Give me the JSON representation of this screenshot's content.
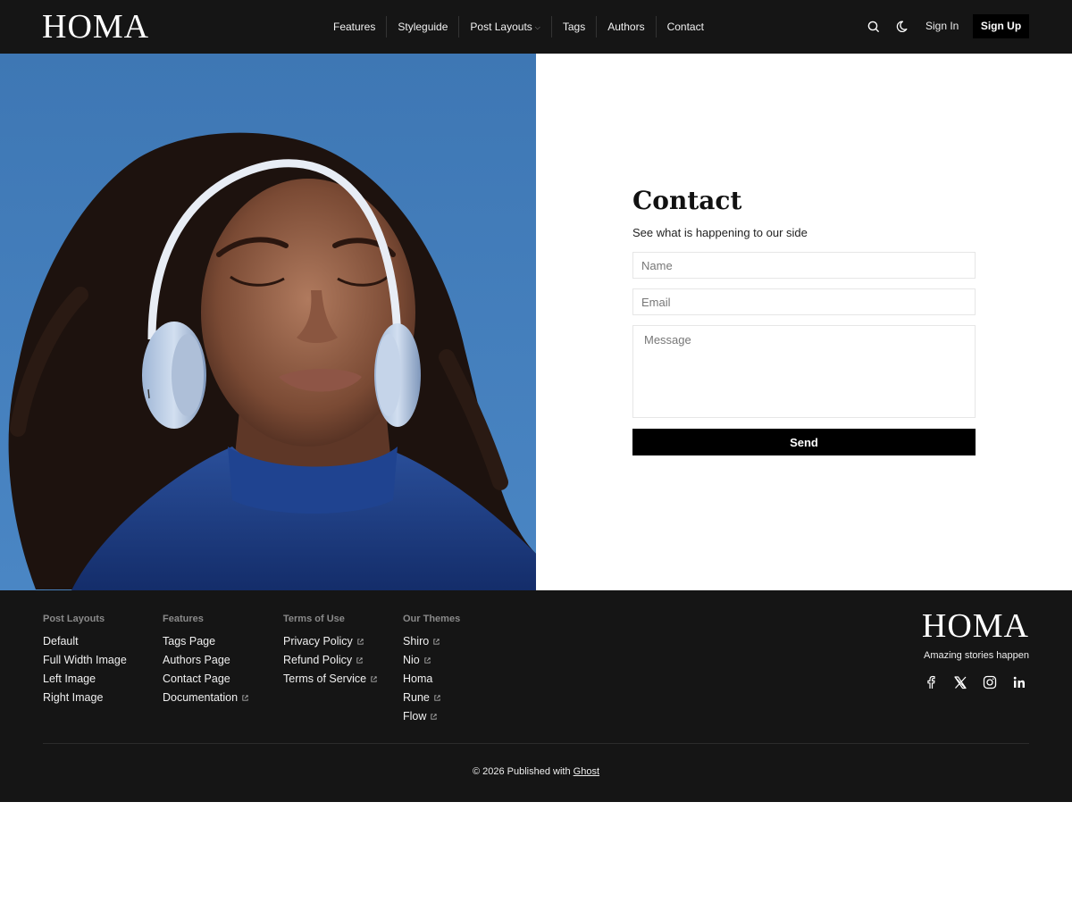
{
  "header": {
    "logo": "HOMA",
    "nav": [
      {
        "label": "Features"
      },
      {
        "label": "Styleguide"
      },
      {
        "label": "Post Layouts",
        "has_dropdown": true
      },
      {
        "label": "Tags"
      },
      {
        "label": "Authors"
      },
      {
        "label": "Contact"
      }
    ],
    "search_icon": "search-icon",
    "theme_icon": "moon-icon",
    "sign_in": "Sign In",
    "sign_up": "Sign Up"
  },
  "hero": {
    "image": "portrait-woman-headphones"
  },
  "contact": {
    "title": "Contact",
    "subtitle": "See what is happening to our side",
    "name_placeholder": "Name",
    "email_placeholder": "Email",
    "message_placeholder": "Message",
    "send_label": "Send"
  },
  "footer": {
    "columns": [
      {
        "title": "Post Layouts",
        "links": [
          {
            "label": "Default"
          },
          {
            "label": "Full Width Image"
          },
          {
            "label": "Left Image"
          },
          {
            "label": "Right Image"
          }
        ]
      },
      {
        "title": "Features",
        "links": [
          {
            "label": "Tags Page"
          },
          {
            "label": "Authors Page"
          },
          {
            "label": "Contact Page"
          },
          {
            "label": "Documentation",
            "external": true
          }
        ]
      },
      {
        "title": "Terms of Use",
        "links": [
          {
            "label": "Privacy Policy",
            "external": true
          },
          {
            "label": "Refund Policy",
            "external": true
          },
          {
            "label": "Terms of Service",
            "external": true
          }
        ]
      },
      {
        "title": "Our Themes",
        "links": [
          {
            "label": "Shiro",
            "external": true
          },
          {
            "label": "Nio",
            "external": true
          },
          {
            "label": "Homa"
          },
          {
            "label": "Rune",
            "external": true
          },
          {
            "label": "Flow",
            "external": true
          }
        ]
      }
    ],
    "logo": "HOMA",
    "tagline": "Amazing stories happen",
    "social": [
      "facebook-icon",
      "x-icon",
      "instagram-icon",
      "linkedin-icon"
    ],
    "copyright_prefix": "© 2026 Published with",
    "copyright_link": "Ghost"
  },
  "colors": {
    "header_bg": "#151515",
    "footer_bg": "#151515",
    "accent": "#000000",
    "hero_sky": "#3f7cba"
  }
}
